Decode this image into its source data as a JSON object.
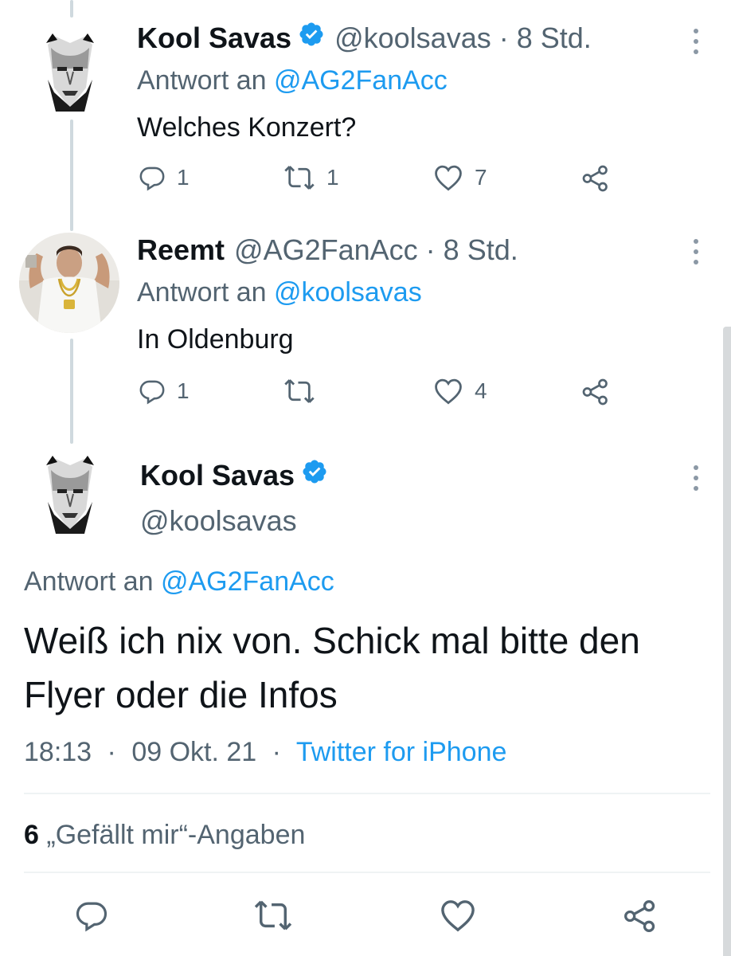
{
  "tweets": [
    {
      "name": "Kool Savas",
      "handle": "@koolsavas",
      "time": "8 Std.",
      "reply_prefix": "Antwort an",
      "reply_to": "@AG2FanAcc",
      "text": "Welches Konzert?",
      "replies": "1",
      "retweets": "1",
      "likes": "7",
      "verified": true
    },
    {
      "name": "Reemt",
      "handle": "@AG2FanAcc",
      "time": "8 Std.",
      "reply_prefix": "Antwort an",
      "reply_to": "@koolsavas",
      "text": "In Oldenburg",
      "replies": "1",
      "retweets": "",
      "likes": "4",
      "verified": false
    }
  ],
  "main": {
    "name": "Kool Savas",
    "handle": "@koolsavas",
    "reply_prefix": "Antwort an",
    "reply_to": "@AG2FanAcc",
    "text": "Weiß ich nix von. Schick mal bitte den Flyer oder die Infos",
    "time": "18:13",
    "date": "09 Okt. 21",
    "source": "Twitter for iPhone",
    "likes_count": "6",
    "likes_label": "„Gefällt mir“-Angaben"
  },
  "separator": "·",
  "colors": {
    "accent": "#1d9bf0",
    "muted": "#536471",
    "text": "#0f1419",
    "thread_line": "#cfd9de"
  },
  "icons": [
    "verified-badge-icon",
    "reply-icon",
    "retweet-icon",
    "like-icon",
    "share-icon",
    "more-icon"
  ]
}
